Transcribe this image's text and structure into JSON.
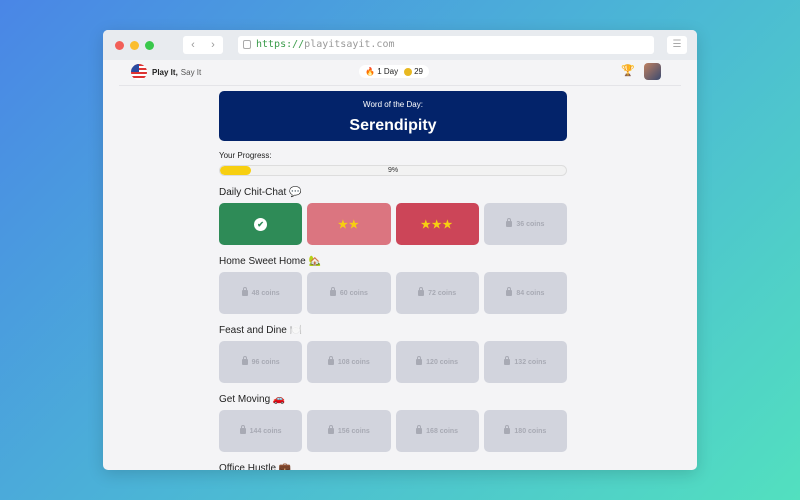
{
  "browser": {
    "url_scheme": "https://",
    "url_host": "playitsayit.com"
  },
  "header": {
    "brand_bold": "Play It,",
    "brand_rest": "Say It",
    "streak": "1 Day",
    "coins": "29"
  },
  "word_of_day": {
    "label": "Word of the Day:",
    "word": "Serendipity"
  },
  "progress": {
    "label": "Your Progress:",
    "percent": 9,
    "text": "9%"
  },
  "sections": [
    {
      "title": "Daily Chit-Chat 💬",
      "tiles": [
        {
          "state": "completed"
        },
        {
          "state": "stars",
          "stars": "★★"
        },
        {
          "state": "stars",
          "stars": "★★★"
        },
        {
          "state": "locked",
          "label": "36 coins"
        }
      ]
    },
    {
      "title": "Home Sweet Home 🏡",
      "tiles": [
        {
          "state": "locked",
          "label": "48 coins"
        },
        {
          "state": "locked",
          "label": "60 coins"
        },
        {
          "state": "locked",
          "label": "72 coins"
        },
        {
          "state": "locked",
          "label": "84 coins"
        }
      ]
    },
    {
      "title": "Feast and Dine 🍽️",
      "tiles": [
        {
          "state": "locked",
          "label": "96 coins"
        },
        {
          "state": "locked",
          "label": "108 coins"
        },
        {
          "state": "locked",
          "label": "120 coins"
        },
        {
          "state": "locked",
          "label": "132 coins"
        }
      ]
    },
    {
      "title": "Get Moving 🚗",
      "tiles": [
        {
          "state": "locked",
          "label": "144 coins"
        },
        {
          "state": "locked",
          "label": "156 coins"
        },
        {
          "state": "locked",
          "label": "168 coins"
        },
        {
          "state": "locked",
          "label": "180 coins"
        }
      ]
    },
    {
      "title": "Office Hustle 💼",
      "tiles": []
    }
  ]
}
